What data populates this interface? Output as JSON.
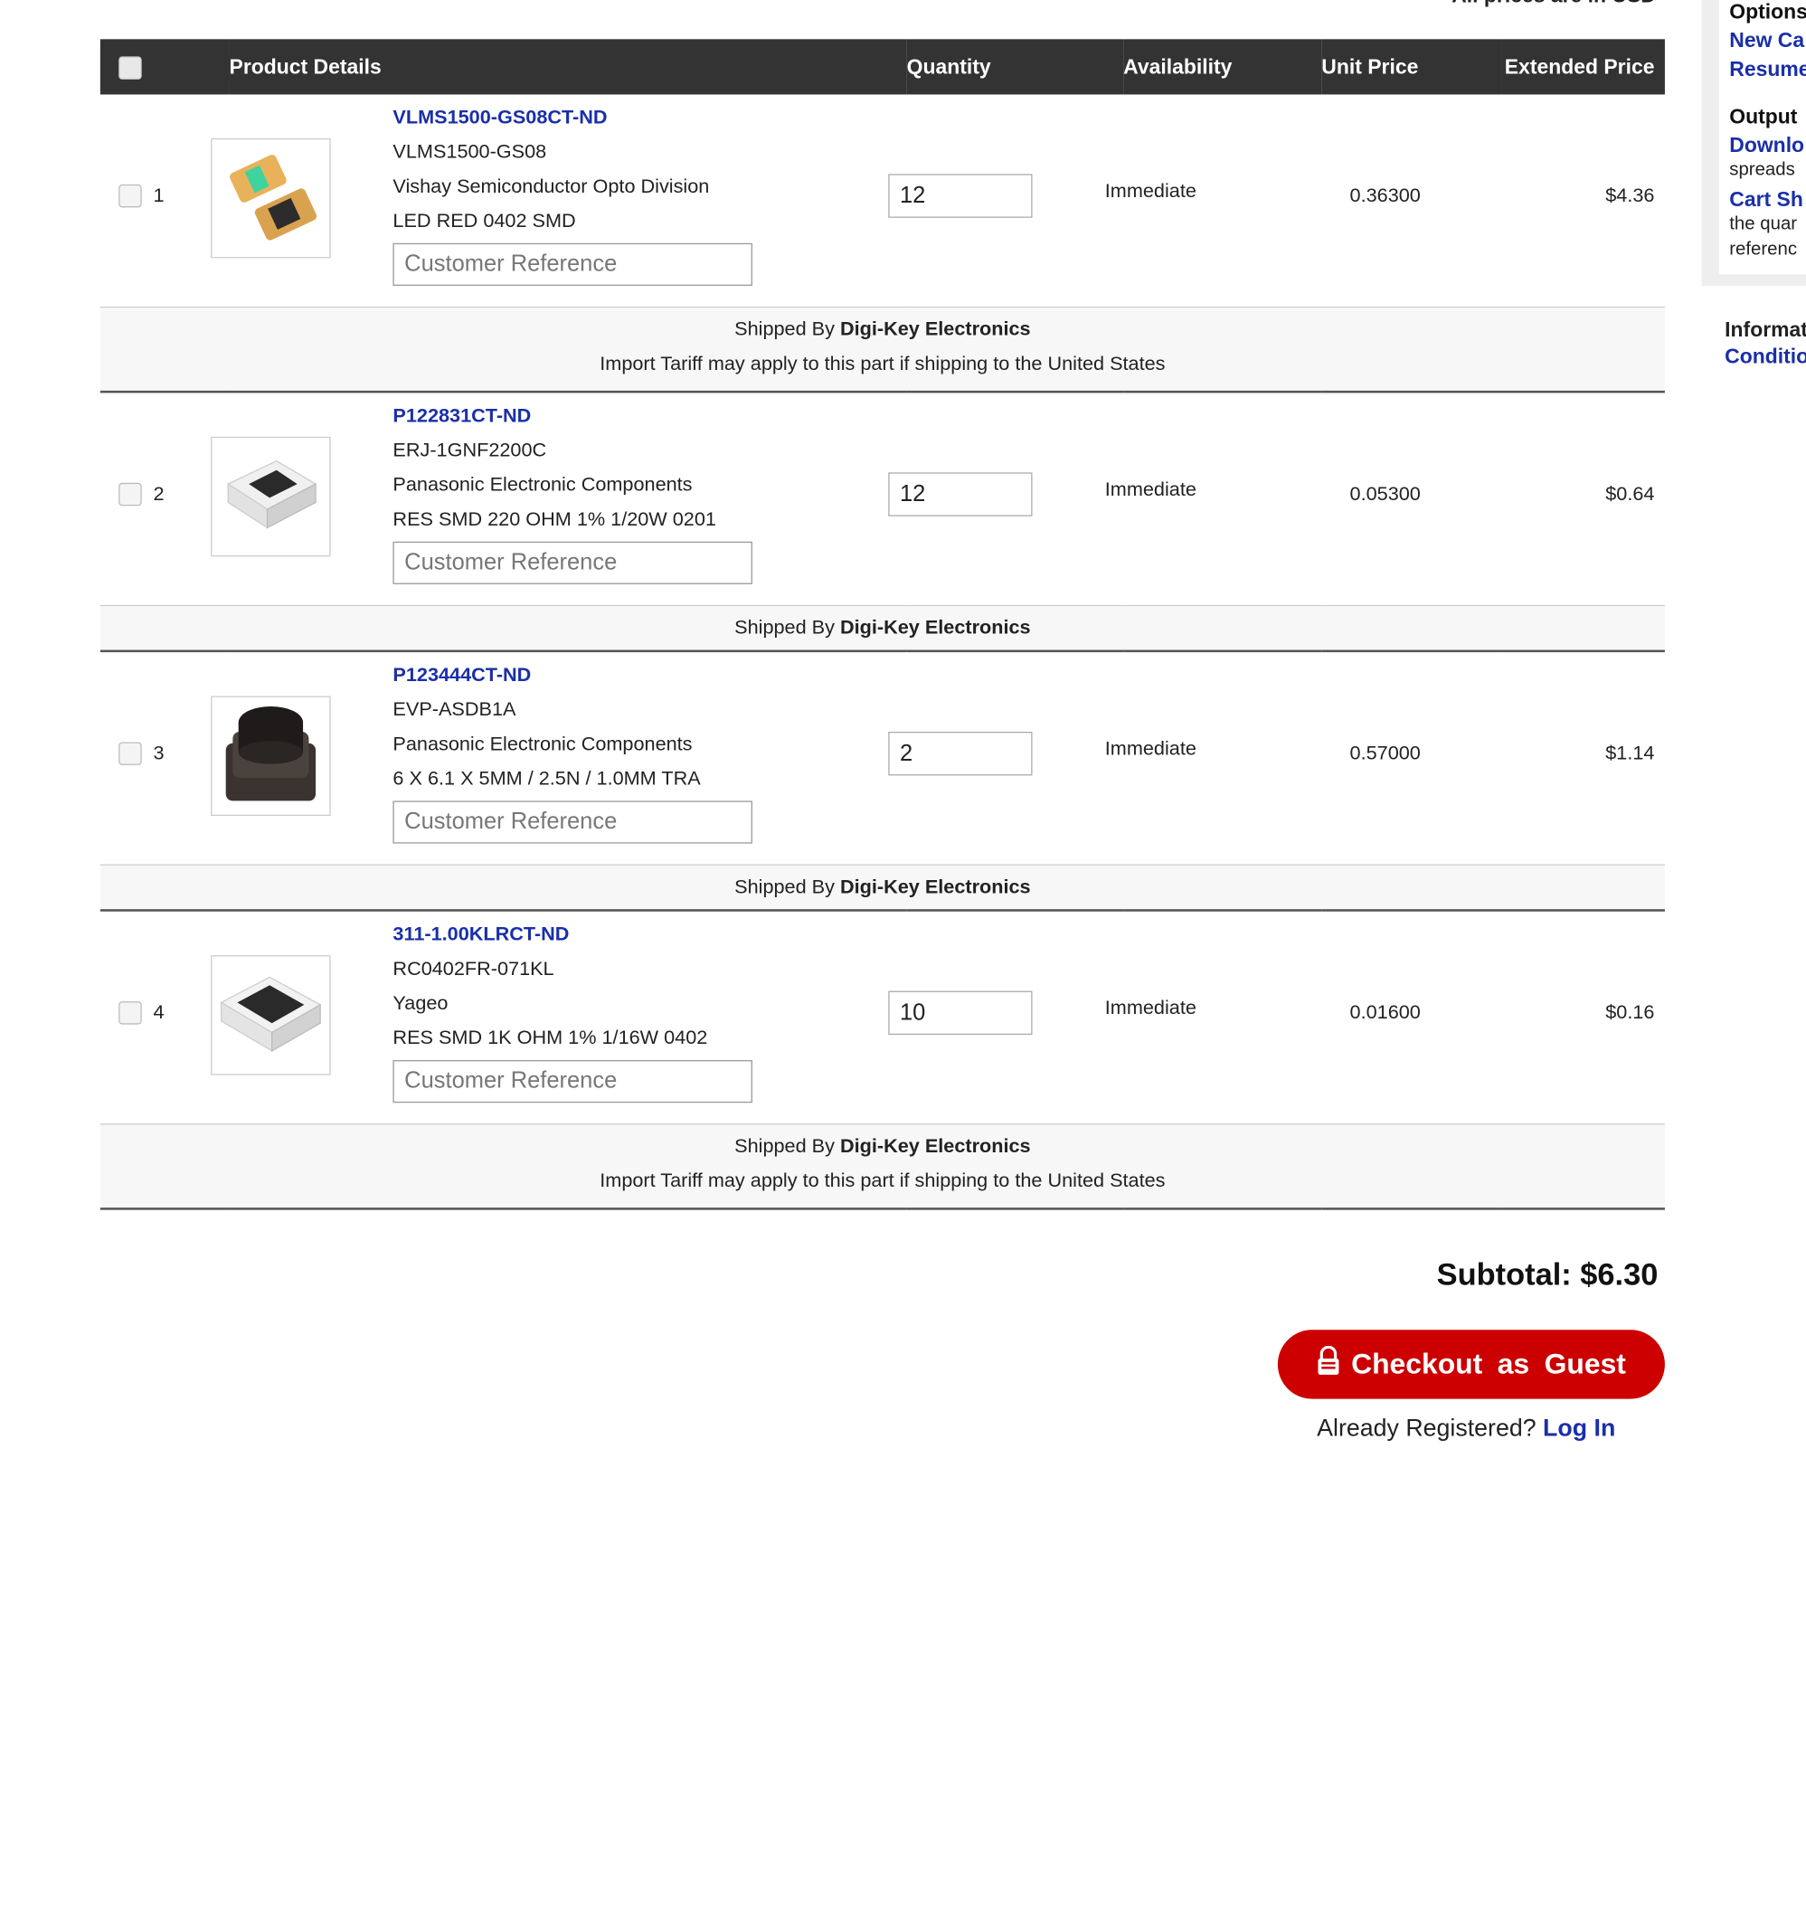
{
  "prices_note": "All prices are in USD",
  "table": {
    "headers": {
      "product_details": "Product Details",
      "quantity": "Quantity",
      "availability": "Availability",
      "unit_price": "Unit Price",
      "extended_price": "Extended Price"
    }
  },
  "items": [
    {
      "num": "1",
      "part_number": "VLMS1500-GS08CT-ND",
      "mfr_part": "VLMS1500-GS08",
      "manufacturer": "Vishay Semiconductor Opto Division",
      "description": "LED RED 0402 SMD",
      "customer_ref_placeholder": "Customer Reference",
      "quantity": "12",
      "availability": "Immediate",
      "unit_price": "0.36300",
      "extended_price": "$4.36",
      "shipped_by_prefix": "Shipped By",
      "shipped_by": "Digi-Key Electronics",
      "tariff_note": "Import Tariff may apply to this part if shipping to the United States"
    },
    {
      "num": "2",
      "part_number": "P122831CT-ND",
      "mfr_part": "ERJ-1GNF2200C",
      "manufacturer": "Panasonic Electronic Components",
      "description": "RES SMD 220 OHM 1% 1/20W 0201",
      "customer_ref_placeholder": "Customer Reference",
      "quantity": "12",
      "availability": "Immediate",
      "unit_price": "0.05300",
      "extended_price": "$0.64",
      "shipped_by_prefix": "Shipped By",
      "shipped_by": "Digi-Key Electronics",
      "tariff_note": ""
    },
    {
      "num": "3",
      "part_number": "P123444CT-ND",
      "mfr_part": "EVP-ASDB1A",
      "manufacturer": "Panasonic Electronic Components",
      "description": "6 X 6.1 X 5MM / 2.5N / 1.0MM TRA",
      "customer_ref_placeholder": "Customer Reference",
      "quantity": "2",
      "availability": "Immediate",
      "unit_price": "0.57000",
      "extended_price": "$1.14",
      "shipped_by_prefix": "Shipped By",
      "shipped_by": "Digi-Key Electronics",
      "tariff_note": ""
    },
    {
      "num": "4",
      "part_number": "311-1.00KLRCT-ND",
      "mfr_part": "RC0402FR-071KL",
      "manufacturer": "Yageo",
      "description": "RES SMD 1K OHM 1% 1/16W 0402",
      "customer_ref_placeholder": "Customer Reference",
      "quantity": "10",
      "availability": "Immediate",
      "unit_price": "0.01600",
      "extended_price": "$0.16",
      "shipped_by_prefix": "Shipped By",
      "shipped_by": "Digi-Key Electronics",
      "tariff_note": "Import Tariff may apply to this part if shipping to the United States"
    }
  ],
  "subtotal": "Subtotal: $6.30",
  "checkout": {
    "label": "Checkout as Guest",
    "lock_icon": "lock-icon",
    "registered_text": "Already Registered?",
    "login_label": "Log In"
  },
  "sidebar": {
    "options_heading": "Options",
    "new_cart": "New Ca",
    "resume": "Resume",
    "output_heading": "Output",
    "download": "Downlo",
    "download_text": "spreads",
    "cart_share": "Cart Sh",
    "cart_share_text1": "the quar",
    "cart_share_text2": "referenc",
    "info_heading": "Informat",
    "conditions": "Conditio"
  },
  "colors": {
    "header_bg": "#333333",
    "link": "#1a2fa8",
    "checkout_red": "#cc0000"
  }
}
